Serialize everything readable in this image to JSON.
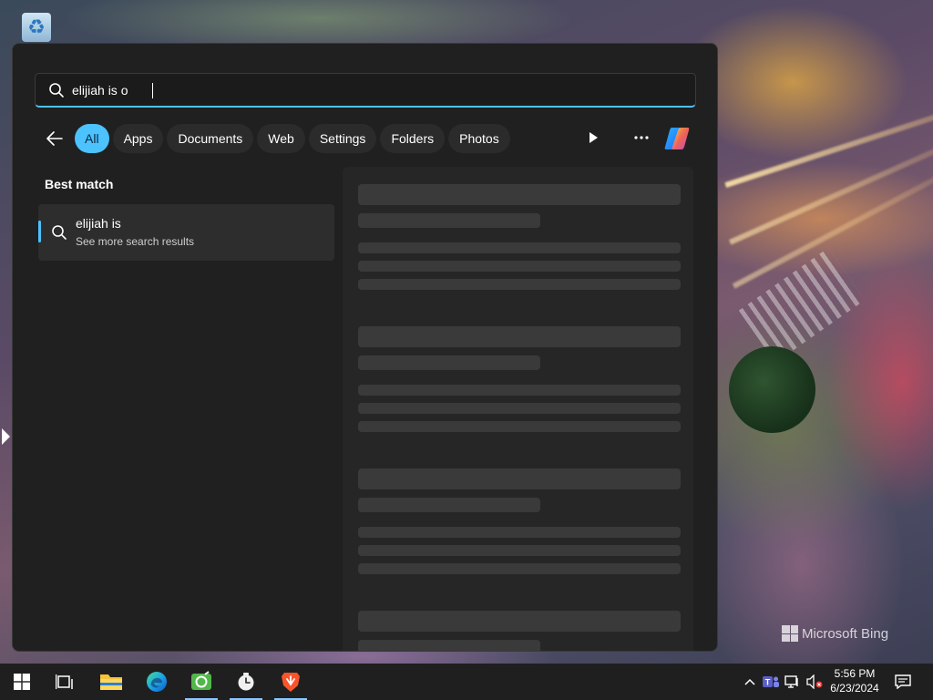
{
  "search": {
    "query": "elijiah is o",
    "filters": [
      "All",
      "Apps",
      "Documents",
      "Web",
      "Settings",
      "Folders",
      "Photos"
    ],
    "active_filter": "All"
  },
  "results": {
    "heading": "Best match",
    "best_match": {
      "title": "elijiah is",
      "subtitle": "See more search results",
      "icon": "search-icon"
    }
  },
  "wallpaper": {
    "watermark": "Microsoft Bing"
  },
  "taskbar": {
    "apps": [
      "start-icon",
      "task-view-icon",
      "file-explorer-icon",
      "edge-icon",
      "greenshot-icon",
      "clock-app-icon",
      "brave-icon"
    ],
    "tray": [
      "chevron-up-icon",
      "teams-icon",
      "network-icon",
      "volume-muted-icon"
    ],
    "time": "5:56 PM",
    "date": "6/23/2024"
  },
  "colors": {
    "accent": "#4cc2ff",
    "panel": "#202020",
    "taskbar": "#1f1f1f"
  }
}
